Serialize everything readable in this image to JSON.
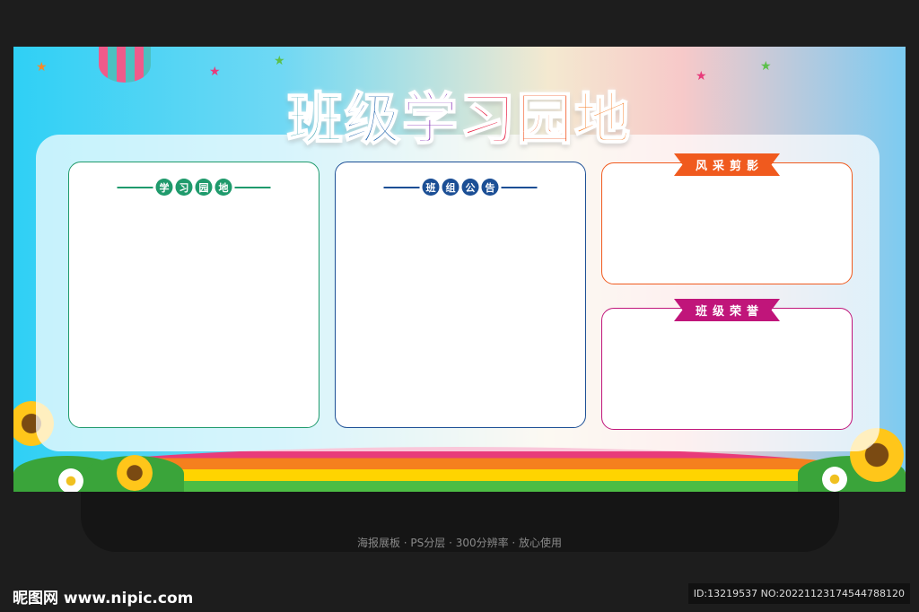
{
  "poster": {
    "title_chars": [
      "班",
      "级",
      "学",
      "习",
      "园",
      "地"
    ],
    "sections": [
      {
        "label": [
          "学",
          "习",
          "园",
          "地"
        ],
        "color": "#1f9a6c"
      },
      {
        "label": [
          "班",
          "组",
          "公",
          "告"
        ],
        "color": "#1c4f95"
      },
      {
        "label": "风采剪影",
        "color": "#f05a1e"
      },
      {
        "label": "班级荣誉",
        "color": "#c0157a"
      }
    ]
  },
  "caption": "海报展板 · PS分层 · 300分辨率 · 放心使用",
  "watermark": {
    "logo": "昵图网 www.nipic.com",
    "id": "ID:13219537 NO:20221123174544788120"
  }
}
